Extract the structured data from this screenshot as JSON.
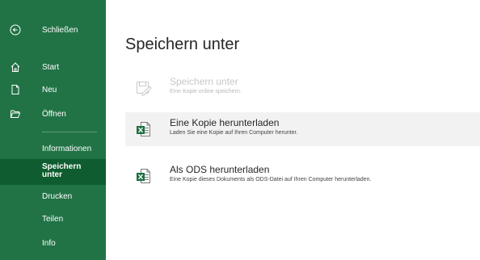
{
  "sidebar": {
    "close_label": "Schließen",
    "items": [
      {
        "label": "Start",
        "icon": "home-icon"
      },
      {
        "label": "Neu",
        "icon": "new-document-icon"
      },
      {
        "label": "Öffnen",
        "icon": "open-folder-icon"
      }
    ],
    "text_items": [
      {
        "label": "Informationen"
      },
      {
        "label": "Speichern unter",
        "selected": true
      },
      {
        "label": "Drucken"
      },
      {
        "label": "Teilen"
      },
      {
        "label": "Info"
      }
    ],
    "colors": {
      "background": "#217346",
      "selected": "#0e5c2f"
    }
  },
  "main": {
    "title": "Speichern unter",
    "options": [
      {
        "title": "Speichern unter",
        "description": "Eine Kopie online speichern.",
        "icon": "save-as-icon",
        "disabled": true
      },
      {
        "title": "Eine Kopie herunterladen",
        "description": "Laden Sie eine Kopie auf Ihren Computer herunter.",
        "icon": "excel-file-icon",
        "hover": true
      },
      {
        "title": "Als ODS herunterladen",
        "description": "Eine Kopie dieses Dokuments als ODS-Datei auf Ihren Computer herunterladen.",
        "icon": "excel-file-icon"
      }
    ]
  }
}
